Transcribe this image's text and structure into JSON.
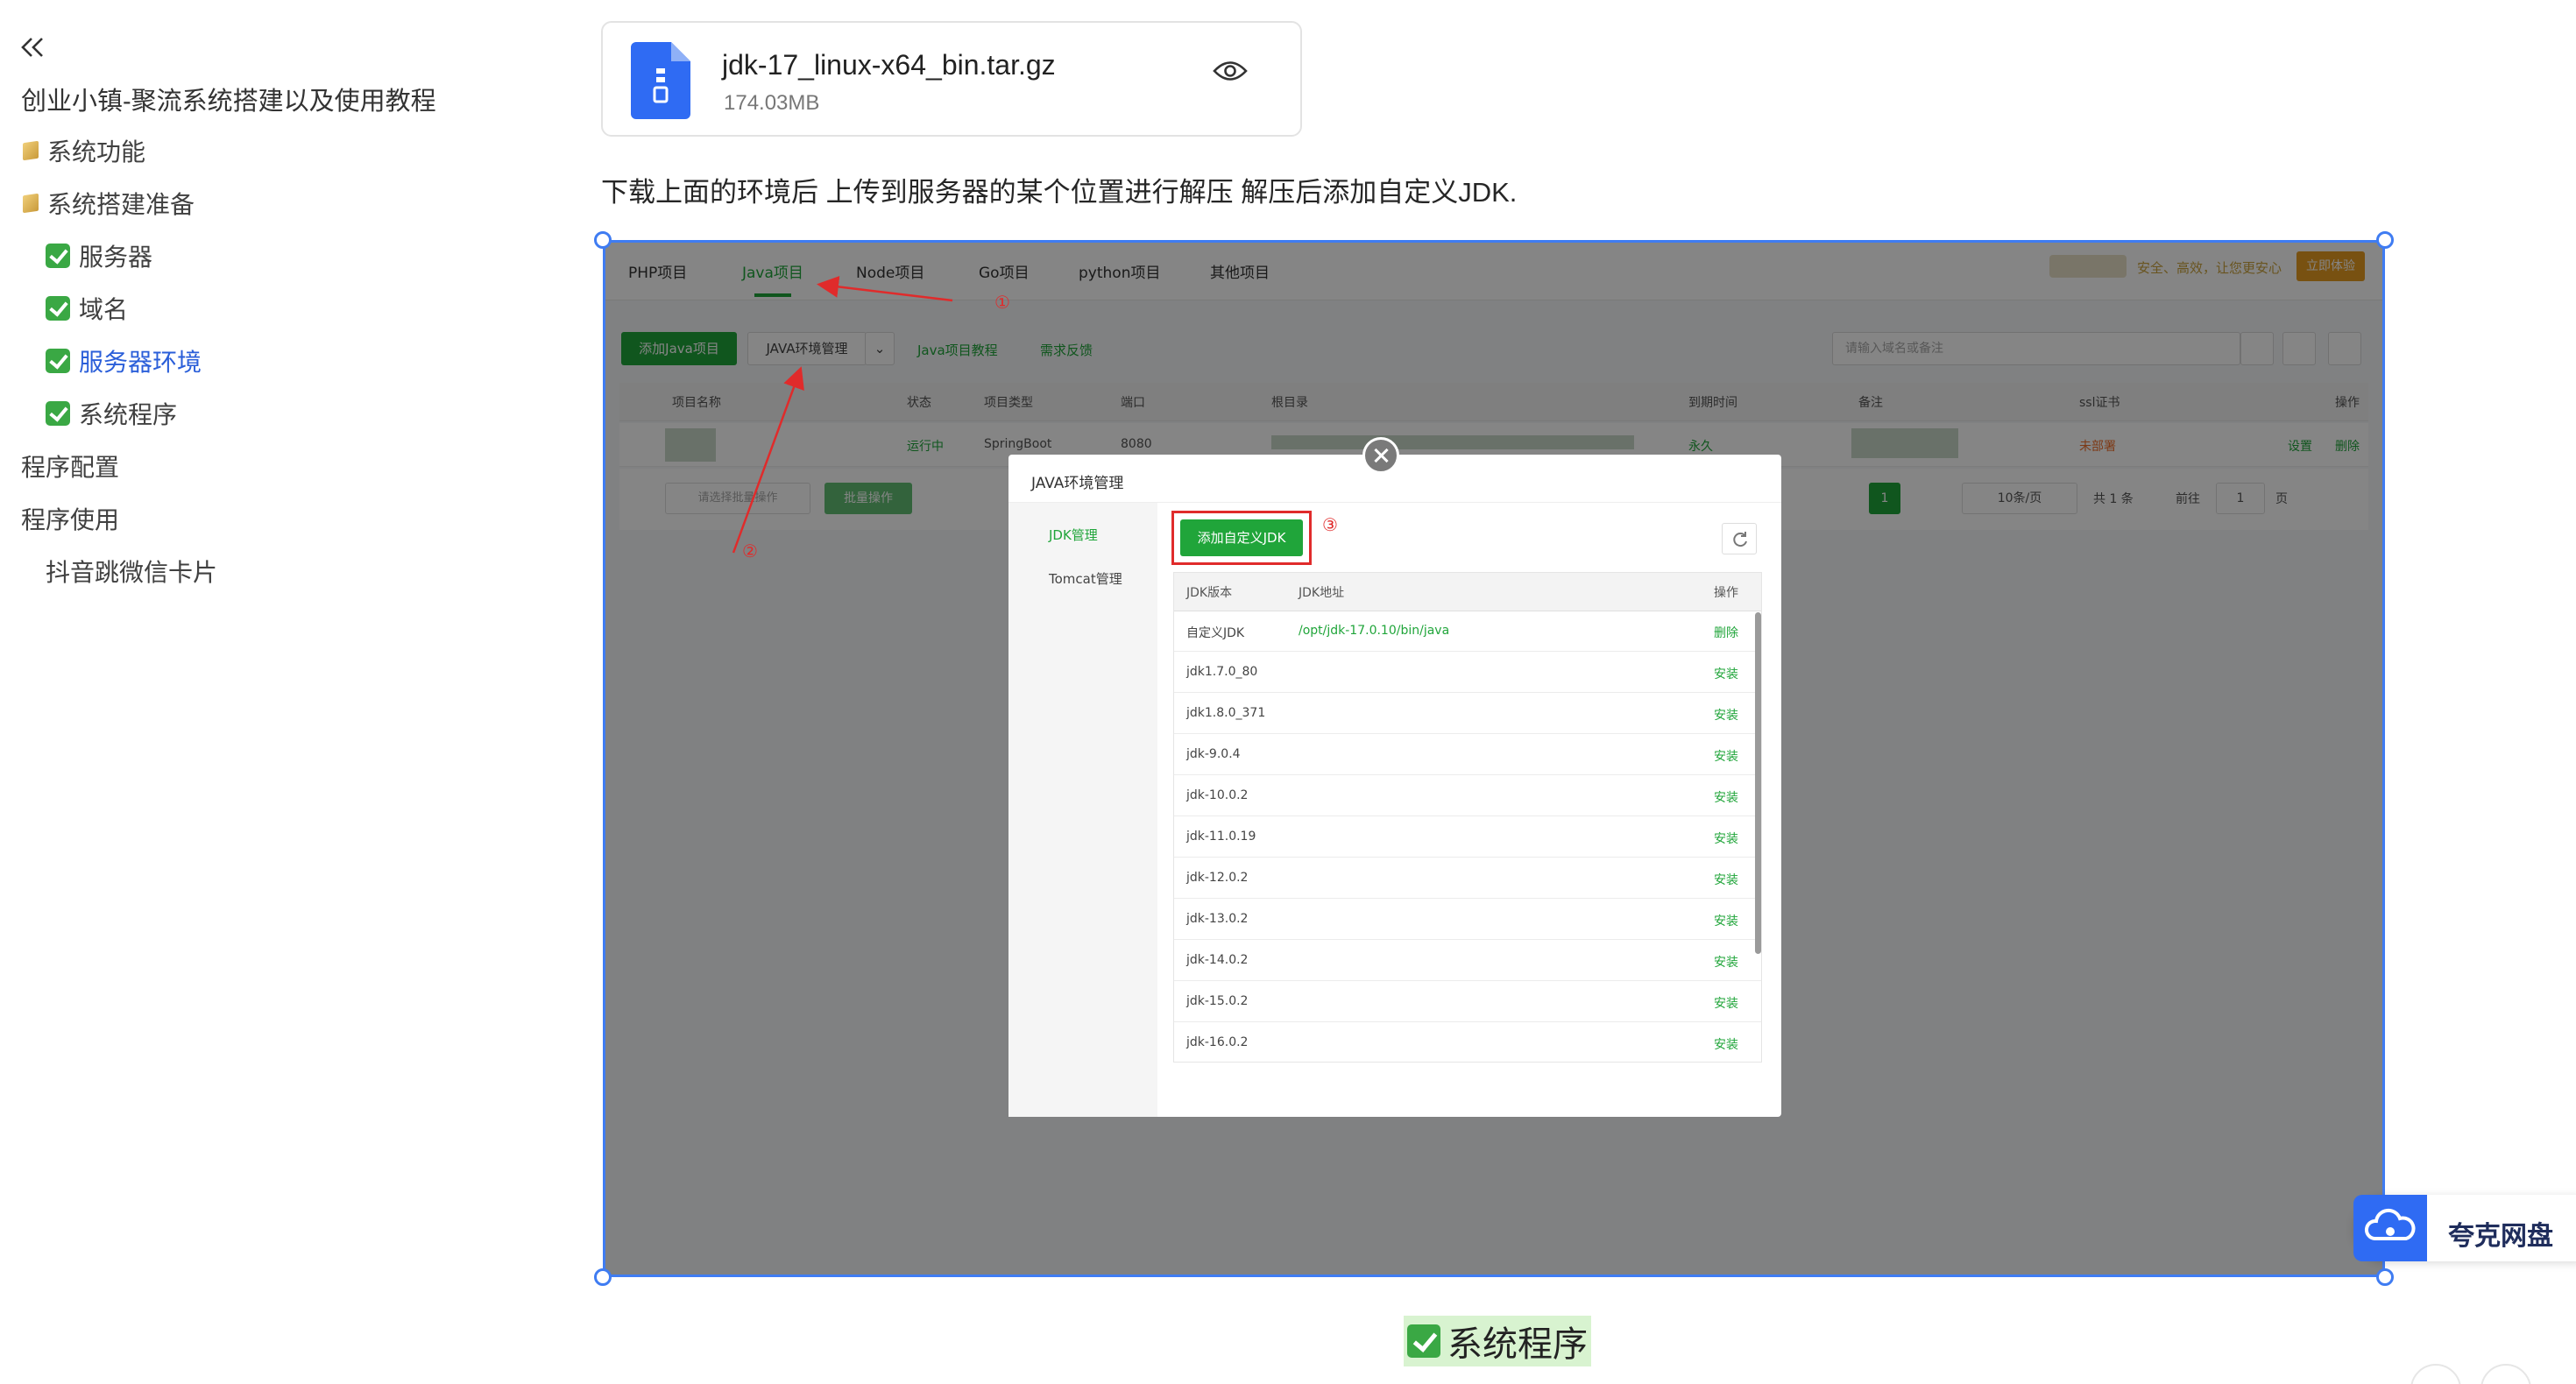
{
  "sidebar": {
    "doc_title": "创业小镇-聚流系统搭建以及使用教程",
    "items": [
      {
        "label": "系统功能",
        "icon": "folder-icon"
      },
      {
        "label": "系统搭建准备",
        "icon": "folder-icon"
      },
      {
        "label": "服务器",
        "icon": "check-icon"
      },
      {
        "label": "域名",
        "icon": "check-icon"
      },
      {
        "label": "服务器环境",
        "icon": "check-icon",
        "active": true
      },
      {
        "label": "系统程序",
        "icon": "check-icon"
      },
      {
        "label": "程序配置"
      },
      {
        "label": "程序使用"
      },
      {
        "label": "抖音跳微信卡片"
      }
    ]
  },
  "file": {
    "name": "jdk-17_linux-x64_bin.tar.gz",
    "size": "174.03MB"
  },
  "paragraph": "下载上面的环境后 上传到服务器的某个位置进行解压 解压后添加自定义JDK.",
  "screenshot": {
    "tabs": [
      "PHP项目",
      "Java项目",
      "Node项目",
      "Go项目",
      "python项目",
      "其他项目"
    ],
    "promo_text": "安全、高效，让您更安心",
    "promo_button": "立即体验",
    "toolbar": {
      "add_java": "添加Java项目",
      "java_env": "JAVA环境管理",
      "tutorial": "Java项目教程",
      "feedback": "需求反馈",
      "search_placeholder": "请输入域名或备注"
    },
    "table_headers": [
      "项目名称",
      "状态",
      "项目类型",
      "端口",
      "根目录",
      "到期时间",
      "备注",
      "ssl证书",
      "操作"
    ],
    "row": {
      "status": "运行中",
      "type": "SpringBoot",
      "port": "8080",
      "expiry": "永久",
      "ssl": "未部署",
      "op_settings": "设置",
      "op_delete": "删除"
    },
    "footer": {
      "batch_select": "请选择批量操作",
      "batch_btn": "批量操作",
      "page_current": "1",
      "page_size": "10条/页",
      "total": "共 1 条",
      "goto": "前往",
      "goto_value": "1",
      "page_unit": "页"
    },
    "markers": [
      "①",
      "②",
      "③"
    ],
    "modal": {
      "title": "JAVA环境管理",
      "side_items": [
        "JDK管理",
        "Tomcat管理"
      ],
      "add_button": "添加自定义JDK",
      "table_headers": [
        "JDK版本",
        "JDK地址",
        "操作"
      ],
      "rows": [
        {
          "version": "自定义JDK",
          "path": "/opt/jdk-17.0.10/bin/java",
          "op": "删除"
        },
        {
          "version": "jdk1.7.0_80",
          "path": "",
          "op": "安装"
        },
        {
          "version": "jdk1.8.0_371",
          "path": "",
          "op": "安装"
        },
        {
          "version": "jdk-9.0.4",
          "path": "",
          "op": "安装"
        },
        {
          "version": "jdk-10.0.2",
          "path": "",
          "op": "安装"
        },
        {
          "version": "jdk-11.0.19",
          "path": "",
          "op": "安装"
        },
        {
          "version": "jdk-12.0.2",
          "path": "",
          "op": "安装"
        },
        {
          "version": "jdk-13.0.2",
          "path": "",
          "op": "安装"
        },
        {
          "version": "jdk-14.0.2",
          "path": "",
          "op": "安装"
        },
        {
          "version": "jdk-15.0.2",
          "path": "",
          "op": "安装"
        },
        {
          "version": "jdk-16.0.2",
          "path": "",
          "op": "安装"
        }
      ]
    }
  },
  "quark_badge": "夸克网盘",
  "next_heading": "系统程序",
  "colors": {
    "accent_blue": "#3f7cf2",
    "bt_green": "#20a53a",
    "annotation_red": "#e02b2b",
    "heading_highlight": "#d8f3d0"
  }
}
